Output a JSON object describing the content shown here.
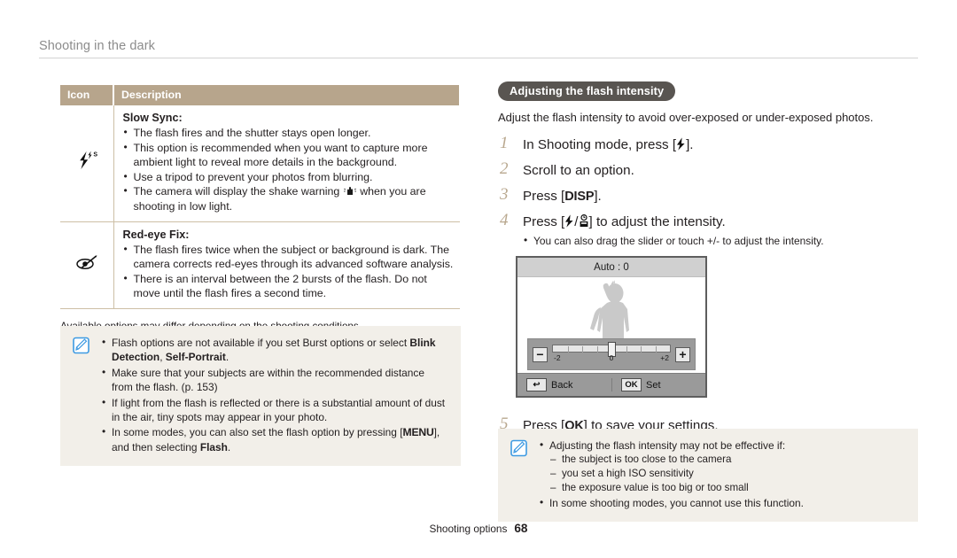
{
  "running_head": "Shooting in the dark",
  "table": {
    "headers": [
      "Icon",
      "Description"
    ],
    "rows": [
      {
        "icon_name": "slow-sync-flash-icon",
        "title": "Slow Sync:",
        "bullets": [
          "The flash fires and the shutter stays open longer.",
          "This option is recommended when you want to capture more ambient light to reveal more details in the background.",
          "Use a tripod to prevent your photos from blurring.",
          "The camera will display the shake warning  when you are shooting in low light."
        ]
      },
      {
        "icon_name": "red-eye-fix-icon",
        "title": "Red-eye Fix:",
        "bullets": [
          "The flash fires twice when the subject or background is dark. The camera corrects red-eyes through its advanced software analysis.",
          "There is an interval between the 2 bursts of the flash. Do not move until the flash fires a second time."
        ]
      }
    ],
    "footnote": "Available options may differ depending on the shooting conditions."
  },
  "note_left": {
    "bullets": [
      "Flash options are not available if you set Burst options or select Blink Detection, Self-Portrait.",
      "Make sure that your subjects are within the recommended distance from the flash. (p. 153)",
      "If light from the flash is reflected or there is a substantial amount of dust in the air, tiny spots may appear in your photo.",
      "In some modes, you can also set the flash option by pressing [MENU], and then selecting Flash."
    ],
    "bold_terms": [
      "Blink Detection",
      "Self-Portrait",
      "MENU",
      "Flash"
    ],
    "page_ref": "p. 153"
  },
  "right": {
    "section_badge": "Adjusting the flash intensity",
    "lead": "Adjust the flash intensity to avoid over-exposed or under-exposed photos.",
    "steps": [
      {
        "num": "1",
        "text_before": "In Shooting mode, press [",
        "key": "flash-icon",
        "text_after": "]."
      },
      {
        "num": "2",
        "text_before": "Scroll to an option.",
        "key": "",
        "text_after": ""
      },
      {
        "num": "3",
        "text_before": "Press [",
        "key": "DISP",
        "text_after": "]."
      },
      {
        "num": "4",
        "text_before": "Press [",
        "key": "flash-timer-icons",
        "text_after": "] to adjust the intensity.",
        "sub": [
          "You can also drag the slider or touch +/- to adjust the intensity."
        ]
      },
      {
        "num": "5",
        "text_before": "Press [",
        "key": "OK",
        "text_after": "] to save your settings."
      }
    ]
  },
  "camera_screen": {
    "title": "Auto : 0",
    "slider": {
      "minus_label": "−",
      "plus_label": "+",
      "scale_left": "-2",
      "scale_center": "0",
      "scale_right": "+2",
      "value": 0
    },
    "footer_left_key": "↩",
    "footer_left_label": "Back",
    "footer_right_key": "OK",
    "footer_right_label": "Set"
  },
  "note_right": {
    "bullets": [
      "Adjusting the flash intensity may not be effective if:",
      "In some shooting modes, you cannot use this function."
    ],
    "sub_bullets": [
      "the subject is too close to the camera",
      "you set a high ISO sensitivity",
      "the exposure value is too big or too small"
    ]
  },
  "footer": {
    "label": "Shooting options",
    "page": "68"
  },
  "colors": {
    "table_header_bg": "#b7a58c",
    "table_border": "#cdbfa6",
    "note_bg": "#f2efe9",
    "badge_bg": "#595551",
    "step_number": "#b9a88f",
    "runhead": "#8c8c8c"
  }
}
